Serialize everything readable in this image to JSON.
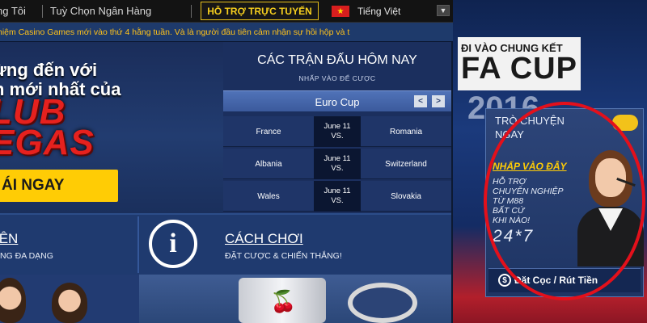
{
  "topbar": {
    "links": [
      "ng Tôi",
      "Tuỳ Chọn Ngân Hàng"
    ],
    "support_label": "HỖ TRỢ TRỰC TUYẾN",
    "language_label": "Tiếng Việt"
  },
  "ticker": {
    "text": "hiệm Casino Games mới vào thứ 4 hằng tuần. Và là người đầu tiên cảm nhận sự hồi hộp và t"
  },
  "hero": {
    "line1": "ừng đến với",
    "line2": "n mới nhất của",
    "big1": "LUB",
    "big2": "EGAS",
    "join_label": "ÁI NGAY"
  },
  "matches": {
    "title": "CÁC TRẬN ĐẤU HÔM NAY",
    "subtitle": "NHẤP VÀO ĐỂ CƯỢC",
    "competition": "Euro Cup",
    "prev_label": "<",
    "next_label": ">",
    "rows": [
      {
        "home": "France",
        "date": "June 11",
        "vs": "VS.",
        "away": "Romania"
      },
      {
        "home": "Albania",
        "date": "June 11",
        "vs": "VS.",
        "away": "Switzerland"
      },
      {
        "home": "Wales",
        "date": "June 11",
        "vs": "VS.",
        "away": "Slovakia"
      }
    ]
  },
  "features": {
    "left_title": "IÊN",
    "left_sub": "NG ĐA DẠNG",
    "how_title": "CÁCH CHƠI",
    "how_sub": "ĐẶT CƯỢC & CHIẾN THẮNG!"
  },
  "banner": {
    "fa_small": "ĐI VÀO CHUNG KẾT",
    "fa_big": "FA CUP",
    "year": "2016"
  },
  "chat": {
    "title": "TRÒ CHUYỆN NGAY",
    "cta": "NHẤP VÀO ĐÂY",
    "lines": [
      "HỖ TRỢ",
      "CHUYÊN NGHIỆP",
      "TỪ M88",
      "BẤT CỨ",
      "KHI NÀO!"
    ],
    "hours": "24*7",
    "deposit_label": "Đặt Cọc / Rút Tiền"
  },
  "colors": {
    "accent_yellow": "#ffcc05",
    "brand_red": "#e6211e",
    "panel_blue": "#1b2f5e",
    "highlight_ellipse": "#e3101b"
  },
  "icons": [
    "flag-vietnam-icon",
    "chevron-down-icon",
    "info-icon",
    "chat-bubble-icon",
    "dollar-icon"
  ]
}
